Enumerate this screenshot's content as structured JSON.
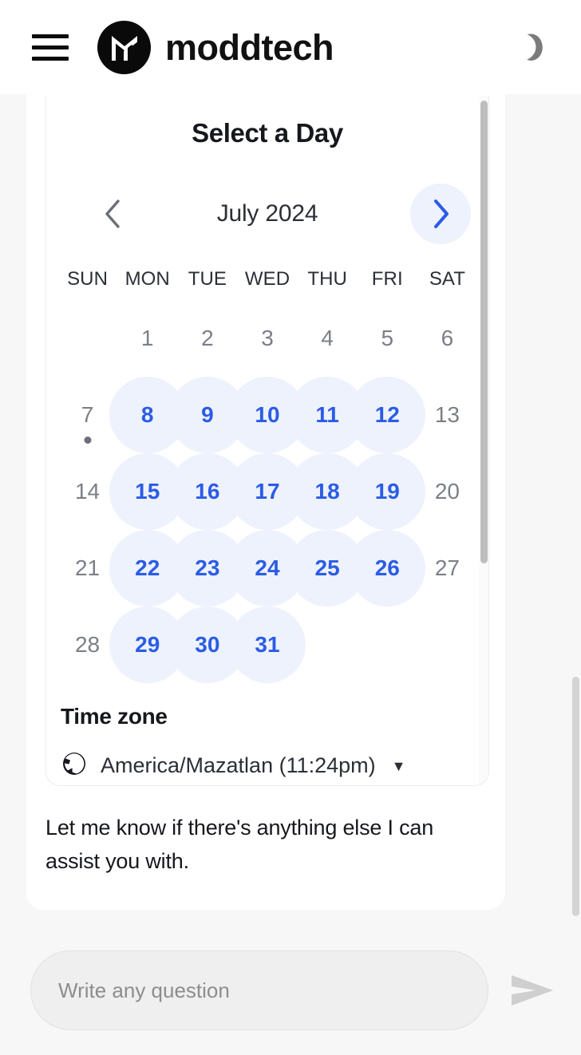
{
  "header": {
    "menu_icon": "hamburger-menu-icon",
    "logo_icon": "moddtech-logo-icon",
    "brand_name": "moddtech",
    "theme_icon": "moon-icon"
  },
  "calendar": {
    "title": "Select a Day",
    "prev_icon": "chevron-left-icon",
    "next_icon": "chevron-right-icon",
    "month_label": "July 2024",
    "weekdays": [
      "SUN",
      "MON",
      "TUE",
      "WED",
      "THU",
      "FRI",
      "SAT"
    ],
    "weeks": [
      [
        {
          "label": "",
          "state": "empty"
        },
        {
          "label": "1",
          "state": "disabled"
        },
        {
          "label": "2",
          "state": "disabled"
        },
        {
          "label": "3",
          "state": "disabled"
        },
        {
          "label": "4",
          "state": "disabled"
        },
        {
          "label": "5",
          "state": "disabled"
        },
        {
          "label": "6",
          "state": "disabled"
        }
      ],
      [
        {
          "label": "7",
          "state": "disabled",
          "today": true
        },
        {
          "label": "8",
          "state": "available"
        },
        {
          "label": "9",
          "state": "available"
        },
        {
          "label": "10",
          "state": "available"
        },
        {
          "label": "11",
          "state": "available"
        },
        {
          "label": "12",
          "state": "available"
        },
        {
          "label": "13",
          "state": "disabled"
        }
      ],
      [
        {
          "label": "14",
          "state": "disabled"
        },
        {
          "label": "15",
          "state": "available"
        },
        {
          "label": "16",
          "state": "available"
        },
        {
          "label": "17",
          "state": "available"
        },
        {
          "label": "18",
          "state": "available"
        },
        {
          "label": "19",
          "state": "available"
        },
        {
          "label": "20",
          "state": "disabled"
        }
      ],
      [
        {
          "label": "21",
          "state": "disabled"
        },
        {
          "label": "22",
          "state": "available"
        },
        {
          "label": "23",
          "state": "available"
        },
        {
          "label": "24",
          "state": "available"
        },
        {
          "label": "25",
          "state": "available"
        },
        {
          "label": "26",
          "state": "available"
        },
        {
          "label": "27",
          "state": "disabled"
        }
      ],
      [
        {
          "label": "28",
          "state": "disabled"
        },
        {
          "label": "29",
          "state": "available"
        },
        {
          "label": "30",
          "state": "available"
        },
        {
          "label": "31",
          "state": "available"
        },
        {
          "label": "",
          "state": "empty"
        },
        {
          "label": "",
          "state": "empty"
        },
        {
          "label": "",
          "state": "empty"
        }
      ]
    ],
    "timezone": {
      "heading": "Time zone",
      "icon": "globe-icon",
      "value": "America/Mazatlan (11:24pm)",
      "caret": "caret-down-icon"
    }
  },
  "chat": {
    "assistant_message": "Let me know if there's anything else I can assist you with."
  },
  "composer": {
    "placeholder": "Write any question",
    "value": "",
    "send_icon": "send-icon"
  },
  "colors": {
    "accent_blue": "#2b5ce5",
    "accent_blue_soft": "#eef2fd",
    "page_background": "#f7f7f7",
    "card_background": "#ffffff",
    "text_primary": "#16181d",
    "text_muted": "#7b7f87"
  }
}
